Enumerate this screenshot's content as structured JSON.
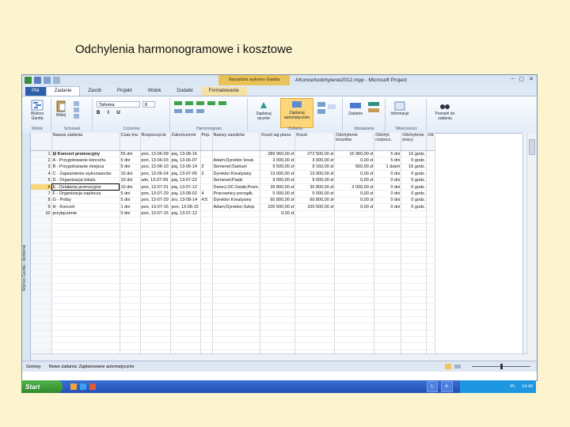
{
  "slide": {
    "title": "Odchylenia harmonogramowe i kosztowe"
  },
  "window": {
    "title": "AKoncertodchylenie2012.mpp - Microsoft Project",
    "context_tab": "Narzędzia wykresu Gantta",
    "controls": [
      "–",
      "▢",
      "✕"
    ]
  },
  "ribbon_tabs": [
    "Plik",
    "Zadanie",
    "Zasób",
    "Projekt",
    "Widok",
    "Dodatki",
    "Formatowanie"
  ],
  "ribbon": {
    "groups": [
      "Widok",
      "Schowek",
      "Czcionka",
      "Harmonogram",
      "Zadania",
      "Wstawianie",
      "Właściwości"
    ],
    "gantt_label": "Wykres Gantta",
    "paste_label": "Wklej",
    "font_name": "Tahoma",
    "font_size": "8",
    "manual_label": "Zaplanuj ręcznie",
    "auto_label": "Zaplanuj automatycznie",
    "task_label": "Zadanie",
    "info_label": "Informacje",
    "scroll_label": "Przewiń do zadania"
  },
  "grid": {
    "columns": [
      "",
      "Nazwa zadania",
      "Czas trw.",
      "Rozpoczęcie",
      "Zakończenie",
      "Pop.",
      "Nazwy zasobów",
      "Koszt wg planu",
      "Koszt",
      "Odchylenie kosztów",
      "Odchyl. rozpocz.",
      "Odchylenie pracy",
      "Od"
    ],
    "rows": [
      [
        "1",
        "⊟ Koncert promocyjny",
        "55 dni",
        "pon, 13-06-09",
        "pią, 13-08-16",
        "",
        "",
        "289 960,00 zł",
        "272 500,00 zł",
        "16 960,00 zł",
        "5 dni",
        "16 godz."
      ],
      [
        "2",
        "A - Przygotowanie koncertu",
        "5 dni",
        "pon, 13-06-03",
        "pią, 13-06-07",
        "",
        "Adam;Dyrektor kreat.",
        "3 000,00 zł",
        "3 000,00 zł",
        "0,00 zł",
        "5 dni",
        "0 godz."
      ],
      [
        "3",
        "B - Przygotowanie miejsca",
        "5 dni",
        "pon, 13-06-10",
        "pią, 13-06-14",
        "2",
        "Semenet;Samuel",
        "9 500,00 zł",
        "9 160,00 zł",
        "560,00 zł",
        "1 dzień",
        "16 godz."
      ],
      [
        "4",
        "C - Zapewnienie wykonawców",
        "10 dni",
        "pon, 13-06-24",
        "pią, 13-07-05",
        "2",
        "Dyrektor Kreatywny",
        "13 000,00 zł",
        "13 000,00 zł",
        "0,00 zł",
        "0 dni",
        "0 godz."
      ],
      [
        "5",
        "D - Organizacja lokalu",
        "10 dni",
        "wto, 13-07-09",
        "pią, 13-07-22",
        "",
        "Semenet;Paski",
        "9 000,00 zł",
        "9 000,00 zł",
        "0,00 zł",
        "0 dni",
        "0 godz."
      ],
      [
        "6",
        "E - Działania promocyjne",
        "10 dni",
        "pon, 13-07-01",
        "pią, 13-07-12",
        "",
        "Dane;LOC;Sztab;Prom.",
        "39 800,00 zł",
        "35 800,00 zł",
        "3 000,00 zł",
        "0 dni",
        "0 godz."
      ],
      [
        "7",
        "F - Organizacja zaplecza",
        "5 dni",
        "pon, 13-07-29",
        "pią, 13-08-02",
        "4",
        "Pracownicy porządk.",
        "5 000,00 zł",
        "5 000,00 zł",
        "0,00 zł",
        "0 dni",
        "0 godz."
      ],
      [
        "8",
        "G - Próby",
        "5 dni",
        "pon, 13-07-29",
        "śro, 13-08-14",
        "4;5",
        "Dyrektor Kreatywny",
        "60 800,00 zł",
        "60 800,00 zł",
        "0,00 zł",
        "0 dni",
        "0 godz."
      ],
      [
        "9",
        "H - Koncert",
        "1 dni",
        "pon, 13-07-15",
        "pon, 13-08-15",
        "",
        "Adam;Dyrektor;Szłop",
        "100 500,00 zł",
        "100 500,00 zł",
        "0,00 zł",
        "0 dni",
        "0 godz."
      ],
      [
        "10",
        "przyłączenie",
        "0 dni",
        "pon, 13-07-15",
        "pią, 13-07-12",
        "",
        "",
        "0,00 zł",
        "",
        "",
        "",
        ""
      ]
    ],
    "selected_row": 5
  },
  "sidebar": {
    "label": "Wykres Gantta - śledzenie"
  },
  "statusbar": {
    "ready": "Gotowy",
    "mode": "Nowe zadania: Zaplanowane automatycznie"
  },
  "taskbar": {
    "start": "Start",
    "buttons": [
      "1.",
      "4."
    ],
    "tray_text": "PL",
    "clock": "14:40"
  }
}
